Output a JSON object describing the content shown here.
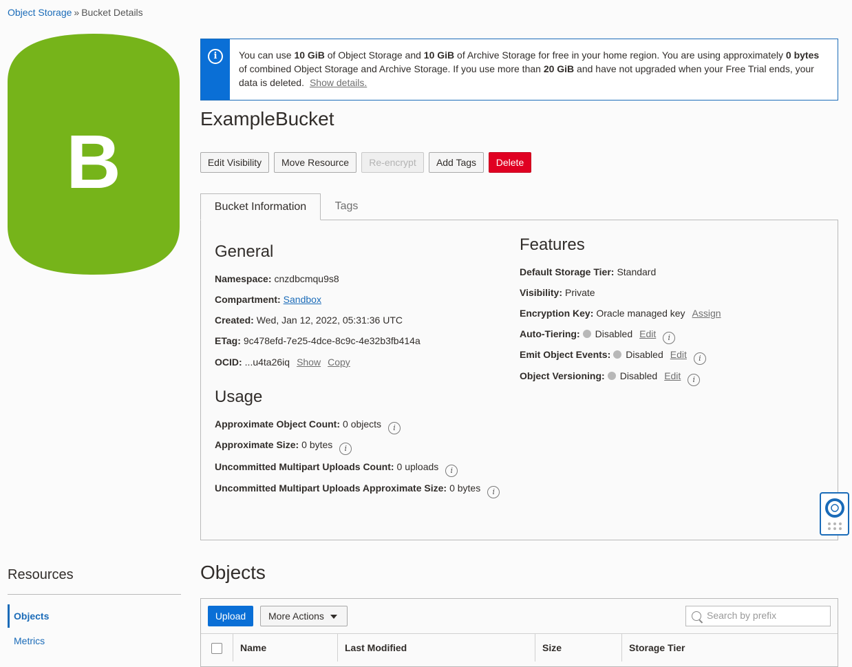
{
  "breadcrumb": {
    "root": "Object Storage",
    "separator": "»",
    "current": "Bucket Details"
  },
  "bucket_icon": {
    "letter": "B",
    "color": "#76b41a"
  },
  "banner": {
    "p1": "You can use ",
    "b1": "10 GiB",
    "p2": " of Object Storage and ",
    "b2": "10 GiB",
    "p3": " of Archive Storage for free in your home region. You are using approximately ",
    "b3": "0 bytes",
    "p4": " of combined Object Storage and Archive Storage. If you use more than ",
    "b4": "20 GiB",
    "p5": " and have not upgraded when your Free Trial ends, your data is deleted.",
    "link": "Show details."
  },
  "title": "ExampleBucket",
  "actions": {
    "edit_visibility": "Edit Visibility",
    "move_resource": "Move Resource",
    "reencrypt": "Re-encrypt",
    "add_tags": "Add Tags",
    "delete": "Delete"
  },
  "tabs": {
    "bucket_info": "Bucket Information",
    "tags": "Tags"
  },
  "general": {
    "heading": "General",
    "namespace": {
      "label": "Namespace:",
      "value": "cnzdbcmqu9s8"
    },
    "compartment": {
      "label": "Compartment:",
      "value": "Sandbox"
    },
    "created": {
      "label": "Created:",
      "value": "Wed, Jan 12, 2022, 05:31:36 UTC"
    },
    "etag": {
      "label": "ETag:",
      "value": "9c478efd-7e25-4dce-8c9c-4e32b3fb414a"
    },
    "ocid": {
      "label": "OCID:",
      "value": "...u4ta26iq",
      "show": "Show",
      "copy": "Copy"
    }
  },
  "usage": {
    "heading": "Usage",
    "object_count": {
      "label": "Approximate Object Count:",
      "value": "0 objects"
    },
    "size": {
      "label": "Approximate Size:",
      "value": "0 bytes"
    },
    "multipart_count": {
      "label": "Uncommitted Multipart Uploads Count:",
      "value": "0 uploads"
    },
    "multipart_size": {
      "label": "Uncommitted Multipart Uploads Approximate Size:",
      "value": "0 bytes"
    }
  },
  "features": {
    "heading": "Features",
    "storage_tier": {
      "label": "Default Storage Tier:",
      "value": "Standard"
    },
    "visibility": {
      "label": "Visibility:",
      "value": "Private"
    },
    "encryption": {
      "label": "Encryption Key:",
      "value": "Oracle managed key",
      "action": "Assign"
    },
    "auto_tiering": {
      "label": "Auto-Tiering:",
      "value": "Disabled",
      "action": "Edit"
    },
    "emit_events": {
      "label": "Emit Object Events:",
      "value": "Disabled",
      "action": "Edit"
    },
    "versioning": {
      "label": "Object Versioning:",
      "value": "Disabled",
      "action": "Edit"
    }
  },
  "resources": {
    "heading": "Resources",
    "items": [
      "Objects",
      "Metrics"
    ]
  },
  "objects": {
    "heading": "Objects",
    "upload": "Upload",
    "more_actions": "More Actions",
    "search_placeholder": "Search by prefix",
    "columns": [
      "Name",
      "Last Modified",
      "Size",
      "Storage Tier"
    ]
  },
  "colors": {
    "link": "#1a6bb8",
    "primary": "#0a6fd6",
    "danger": "#e00022",
    "bucket": "#76b41a"
  }
}
